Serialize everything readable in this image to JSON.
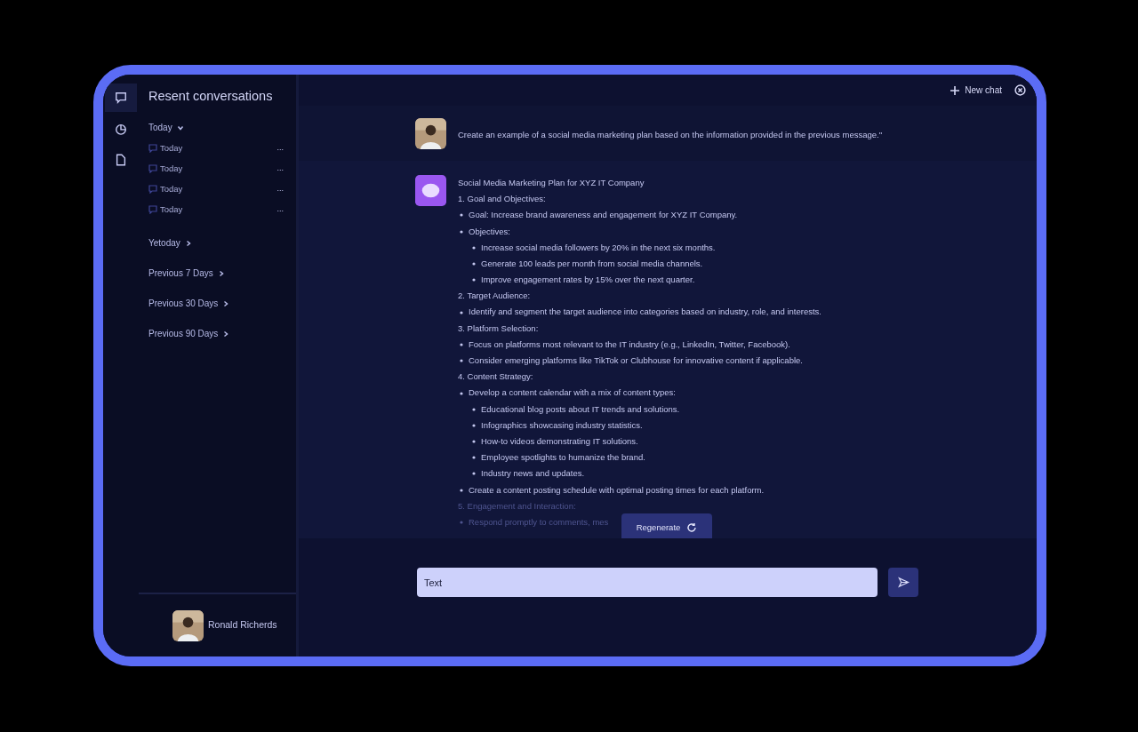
{
  "rail": [
    {
      "kind": "chat",
      "selected": true
    },
    {
      "kind": "chart",
      "selected": false
    },
    {
      "kind": "file",
      "selected": false
    }
  ],
  "sidebar": {
    "title": "Resent conversations",
    "groups": [
      {
        "label": "Today",
        "expanded": true,
        "items": [
          {
            "label": "Today",
            "menu": "..."
          },
          {
            "label": "Today",
            "menu": "..."
          },
          {
            "label": "Today",
            "menu": "..."
          },
          {
            "label": "Today",
            "menu": "..."
          }
        ]
      },
      {
        "label": "Yetoday",
        "expanded": false
      },
      {
        "label": "Previous 7 Days",
        "expanded": false
      },
      {
        "label": "Previous 30 Days",
        "expanded": false
      },
      {
        "label": "Previous 90 Days",
        "expanded": false
      }
    ],
    "user": {
      "name": "Ronald Richerds"
    }
  },
  "topbar": {
    "new_chat": "New chat"
  },
  "user_message": {
    "text": "Create an example of a social media marketing plan based on the information provided in the previous message.\""
  },
  "assistant_message": {
    "lines": [
      {
        "kind": "heading",
        "text": "Social Media Marketing Plan for XYZ IT Company",
        "dimmed": false
      },
      {
        "kind": "heading",
        "text": "1. Goal and Objectives:",
        "dimmed": false
      },
      {
        "kind": "bullet",
        "text": "Goal: Increase brand awareness and engagement for XYZ IT Company.",
        "dimmed": false
      },
      {
        "kind": "bullet",
        "text": "Objectives:",
        "dimmed": false
      },
      {
        "kind": "subbullet",
        "text": "Increase social media followers by 20% in the next six months.",
        "dimmed": false
      },
      {
        "kind": "subbullet",
        "text": "Generate 100 leads per month from social media channels.",
        "dimmed": false
      },
      {
        "kind": "subbullet",
        "text": "Improve engagement rates by 15% over the next quarter.",
        "dimmed": false
      },
      {
        "kind": "heading",
        "text": "2. Target Audience:",
        "dimmed": false
      },
      {
        "kind": "bullet",
        "text": "Identify and segment the target audience into categories based on industry, role, and interests.",
        "dimmed": false
      },
      {
        "kind": "heading",
        "text": "3. Platform Selection:",
        "dimmed": false
      },
      {
        "kind": "bullet",
        "text": "Focus on platforms most relevant to the IT industry (e.g., LinkedIn, Twitter, Facebook).",
        "dimmed": false
      },
      {
        "kind": "bullet",
        "text": "Consider emerging platforms like TikTok or Clubhouse for innovative content if applicable.",
        "dimmed": false
      },
      {
        "kind": "heading",
        "text": "4. Content Strategy:",
        "dimmed": false
      },
      {
        "kind": "bullet",
        "text": "Develop a content calendar with a mix of content types:",
        "dimmed": false
      },
      {
        "kind": "subbullet",
        "text": "Educational blog posts about IT trends and solutions.",
        "dimmed": false
      },
      {
        "kind": "subbullet",
        "text": "Infographics showcasing industry statistics.",
        "dimmed": false
      },
      {
        "kind": "subbullet",
        "text": "How-to videos demonstrating IT solutions.",
        "dimmed": false
      },
      {
        "kind": "subbullet",
        "text": "Employee spotlights to humanize the brand.",
        "dimmed": false
      },
      {
        "kind": "subbullet",
        "text": "Industry news and updates.",
        "dimmed": false
      },
      {
        "kind": "bullet",
        "text": "Create a content posting schedule with optimal posting times for each platform.",
        "dimmed": false
      },
      {
        "kind": "heading",
        "text": "5. Engagement and Interaction:",
        "dimmed": true
      },
      {
        "kind": "bullet",
        "text": "Respond promptly to comments, mes",
        "dimmed": true
      }
    ],
    "regenerate": "Regenerate"
  },
  "composer": {
    "value": "Text"
  }
}
